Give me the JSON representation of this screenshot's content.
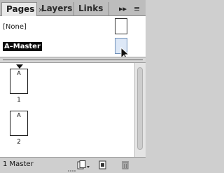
{
  "tabs": [
    {
      "label": "Pages",
      "active": true,
      "close": "×"
    },
    {
      "label": "Layers",
      "active": false
    },
    {
      "label": "Links",
      "active": false
    }
  ],
  "flyout": {
    "arrows": "▸▸",
    "menu": "≡"
  },
  "masters": [
    {
      "label": "[None]",
      "selected": false
    },
    {
      "label": "A–Master",
      "selected": true
    }
  ],
  "pages": [
    {
      "prefix": "A",
      "number": "1"
    },
    {
      "prefix": "A",
      "number": "2"
    }
  ],
  "status": "1 Master",
  "bottom_icons": [
    "edit-page-size-icon",
    "new-page-icon",
    "delete-page-icon"
  ]
}
